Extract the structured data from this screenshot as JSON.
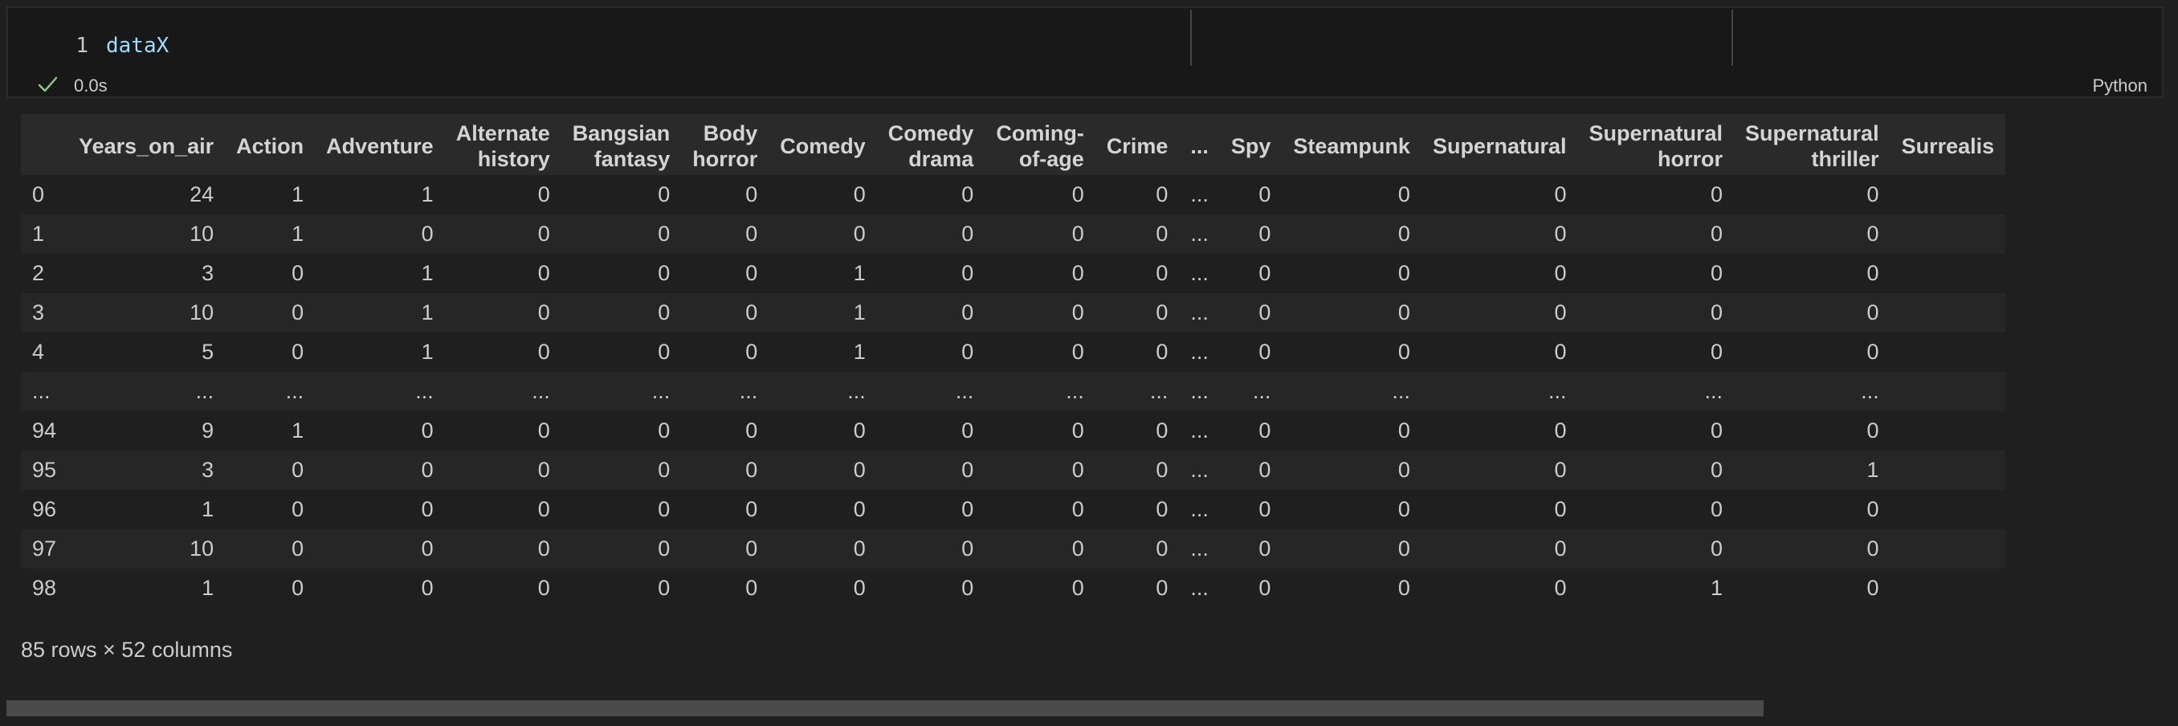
{
  "cell": {
    "line_number": "1",
    "code": "dataX",
    "exec_time": "0.0s",
    "language": "Python"
  },
  "dataframe": {
    "columns": [
      "",
      "Years_on_air",
      "Action",
      "Adventure",
      "Alternate\nhistory",
      "Bangsian\nfantasy",
      "Body\nhorror",
      "Comedy",
      "Comedy\ndrama",
      "Coming-\nof-age",
      "Crime",
      "...",
      "Spy",
      "Steampunk",
      "Supernatural",
      "Supernatural\nhorror",
      "Supernatural\nthriller",
      "Surrealis"
    ],
    "rows": [
      [
        "0",
        "24",
        "1",
        "1",
        "0",
        "0",
        "0",
        "0",
        "0",
        "0",
        "0",
        "...",
        "0",
        "0",
        "0",
        "0",
        "0",
        ""
      ],
      [
        "1",
        "10",
        "1",
        "0",
        "0",
        "0",
        "0",
        "0",
        "0",
        "0",
        "0",
        "...",
        "0",
        "0",
        "0",
        "0",
        "0",
        ""
      ],
      [
        "2",
        "3",
        "0",
        "1",
        "0",
        "0",
        "0",
        "1",
        "0",
        "0",
        "0",
        "...",
        "0",
        "0",
        "0",
        "0",
        "0",
        ""
      ],
      [
        "3",
        "10",
        "0",
        "1",
        "0",
        "0",
        "0",
        "1",
        "0",
        "0",
        "0",
        "...",
        "0",
        "0",
        "0",
        "0",
        "0",
        ""
      ],
      [
        "4",
        "5",
        "0",
        "1",
        "0",
        "0",
        "0",
        "1",
        "0",
        "0",
        "0",
        "...",
        "0",
        "0",
        "0",
        "0",
        "0",
        ""
      ],
      [
        "...",
        "...",
        "...",
        "...",
        "...",
        "...",
        "...",
        "...",
        "...",
        "...",
        "...",
        "...",
        "...",
        "...",
        "...",
        "...",
        "...",
        ""
      ],
      [
        "94",
        "9",
        "1",
        "0",
        "0",
        "0",
        "0",
        "0",
        "0",
        "0",
        "0",
        "...",
        "0",
        "0",
        "0",
        "0",
        "0",
        ""
      ],
      [
        "95",
        "3",
        "0",
        "0",
        "0",
        "0",
        "0",
        "0",
        "0",
        "0",
        "0",
        "...",
        "0",
        "0",
        "0",
        "0",
        "1",
        ""
      ],
      [
        "96",
        "1",
        "0",
        "0",
        "0",
        "0",
        "0",
        "0",
        "0",
        "0",
        "0",
        "...",
        "0",
        "0",
        "0",
        "0",
        "0",
        ""
      ],
      [
        "97",
        "10",
        "0",
        "0",
        "0",
        "0",
        "0",
        "0",
        "0",
        "0",
        "0",
        "...",
        "0",
        "0",
        "0",
        "0",
        "0",
        ""
      ],
      [
        "98",
        "1",
        "0",
        "0",
        "0",
        "0",
        "0",
        "0",
        "0",
        "0",
        "0",
        "...",
        "0",
        "0",
        "0",
        "1",
        "0",
        ""
      ]
    ],
    "shape_text": "85 rows × 52 columns"
  },
  "icons": {
    "status": "check-icon",
    "status_color": "#89d185"
  },
  "colors": {
    "background": "#1f1f1f",
    "cell_background": "#181818",
    "header_background": "#2a2a2a",
    "code_variable": "#9cdcfe"
  }
}
